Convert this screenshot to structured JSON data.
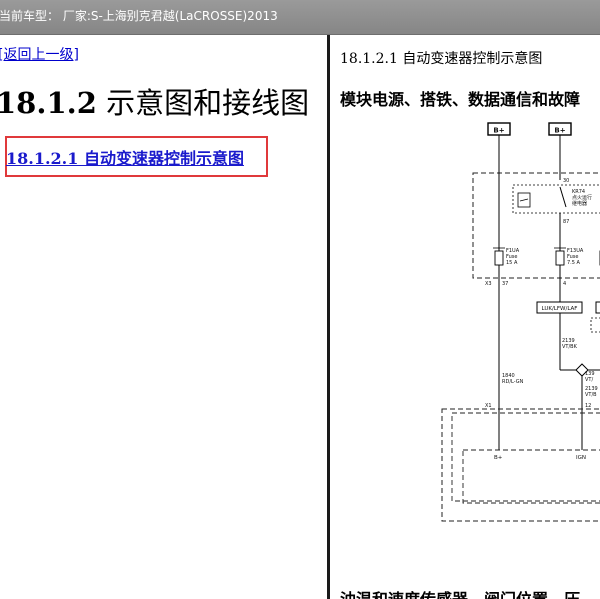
{
  "window": {
    "title": "当前车型： 厂家:S-上海别克君越(LaCROSSE)2013"
  },
  "left": {
    "back_link": "[返回上一级]",
    "heading_number": "18.1.2",
    "heading_text": " 示意图和接线图",
    "toc_link": "18.1.2.1 自动变速器控制示意图"
  },
  "right": {
    "diagram_title_number": "18.1.2.1",
    "diagram_title_text": " 自动变速器控制示意图",
    "section_heading": "模块电源、搭铁、数据通信和故障",
    "bottom_heading": "油温和速度传感器、阀门位置、压",
    "diagram": {
      "b_plus_1": "B+",
      "b_plus_2": "B+",
      "relay_code": "KR74",
      "relay_name_1": "点火运行",
      "relay_name_2": "继电器",
      "pin_30": "30",
      "pin_87": "87",
      "fuse1_name": "F1UA",
      "fuse1_type": "Fuse",
      "fuse1_rating": "15 A",
      "fuse2_name": "F13UA",
      "fuse2_type": "Fuse",
      "fuse2_rating": "7.5 A",
      "connector_x3": "X3",
      "pin_37": "37",
      "pin_4": "4",
      "splice_label": "LUK/LFW/LAF",
      "wire_2139_a": "2139",
      "wire_vtbk_a": "VT/BK",
      "wire_1840": "1840",
      "wire_rdlgn": "RD/L-GN",
      "wire_139": "139",
      "wire_vt_partial": "VT/",
      "wire_2139_b": "2139",
      "wire_vtbk_b": "VT/B",
      "connector_x1": "X1",
      "pin_12": "12",
      "bottom_bplus": "B+",
      "bottom_ign": "IGN"
    }
  }
}
